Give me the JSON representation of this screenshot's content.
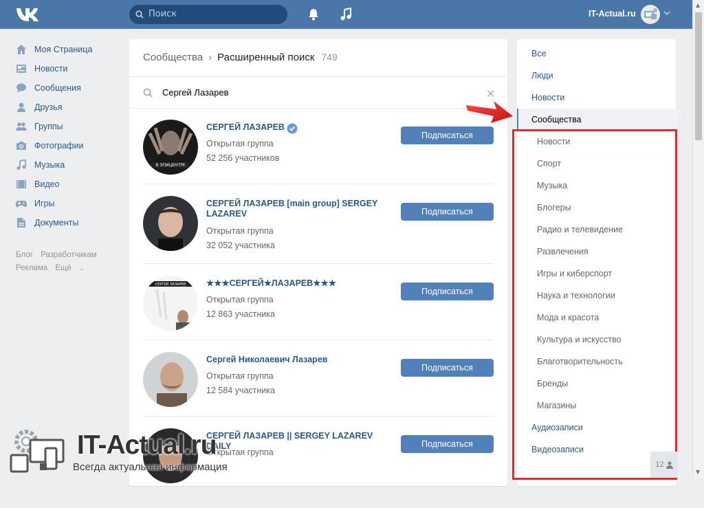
{
  "topbar": {
    "search_placeholder": "Поиск",
    "user_name": "IT-Actual.ru"
  },
  "leftnav": {
    "items": [
      {
        "label": "Моя Страница",
        "icon": "home-icon"
      },
      {
        "label": "Новости",
        "icon": "news-icon"
      },
      {
        "label": "Сообщения",
        "icon": "messages-icon"
      },
      {
        "label": "Друзья",
        "icon": "friends-icon"
      },
      {
        "label": "Группы",
        "icon": "groups-icon"
      },
      {
        "label": "Фотографии",
        "icon": "camera-icon"
      },
      {
        "label": "Музыка",
        "icon": "music-icon"
      },
      {
        "label": "Видео",
        "icon": "video-icon"
      },
      {
        "label": "Игры",
        "icon": "gamepad-icon"
      },
      {
        "label": "Документы",
        "icon": "document-icon"
      }
    ],
    "footer": {
      "blog": "Блог",
      "developers": "Разработчикам",
      "ads": "Реклама",
      "more": "Ещё"
    }
  },
  "main": {
    "breadcrumb_root": "Сообщества",
    "breadcrumb_current": "Расширенный поиск",
    "result_count": "749",
    "query": "Сергей Лазарев",
    "subscribe_label": "Подписаться",
    "results": [
      {
        "name": "СЕРГЕЙ ЛАЗАРЕВ",
        "type": "Открытая группа",
        "members": "52 256 участников",
        "verified": true
      },
      {
        "name": "СЕРГЕЙ ЛАЗАРЕВ [main group] SERGEY LAZAREV",
        "type": "Открытая группа",
        "members": "32 052 участника",
        "verified": false
      },
      {
        "name": "★★★СЕРГЕЙ★ЛАЗАРЕВ★★★",
        "type": "Открытая группа",
        "members": "12 863 участника",
        "verified": false
      },
      {
        "name": "Сергей Николаевич Лазарев",
        "type": "Открытая группа",
        "members": "12 584 участника",
        "verified": false
      },
      {
        "name": "СЕРГЕЙ ЛАЗАРЕВ || SERGEY LAZAREV DAILY",
        "type": "Открытая группа",
        "members": "",
        "verified": false
      }
    ]
  },
  "right": {
    "top": [
      "Все",
      "Люди",
      "Новости"
    ],
    "active": "Сообщества",
    "subcategories": [
      "Новости",
      "Спорт",
      "Музыка",
      "Блогеры",
      "Радио и телевидение",
      "Развлечения",
      "Игры и киберспорт",
      "Наука и технологии",
      "Мода и красота",
      "Культура и искусство",
      "Благотворительность",
      "Бренды",
      "Магазины"
    ],
    "bottom": [
      "Аудиозаписи",
      "Видеозаписи"
    ],
    "online_count": "12"
  },
  "watermark": {
    "title": "IT-Actual.ru",
    "subtitle": "Всегда актуальная информация"
  },
  "colors": {
    "header": "#4a76a8",
    "link": "#2a5885",
    "button": "#5181b8",
    "highlight_red": "#e02b2b"
  }
}
